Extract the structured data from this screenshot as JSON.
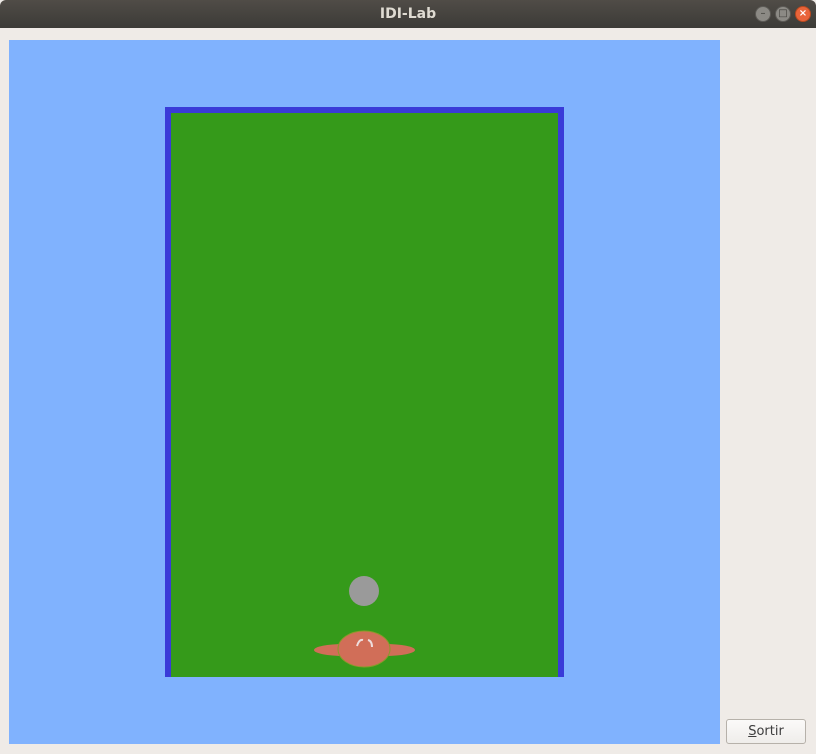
{
  "window": {
    "title": "IDI-Lab",
    "controls": {
      "minimize_icon": "minimize-icon",
      "maximize_icon": "maximize-icon",
      "close_icon": "close-icon"
    }
  },
  "scene": {
    "colors": {
      "background": "#80b2fe",
      "field": "#359a1a",
      "border": "#3a3bd8",
      "ball": "#9a9a9a",
      "player": "#d16e58",
      "player_mark": "#eedddd"
    }
  },
  "buttons": {
    "exit": {
      "mnemonic": "S",
      "rest": "ortir"
    }
  }
}
